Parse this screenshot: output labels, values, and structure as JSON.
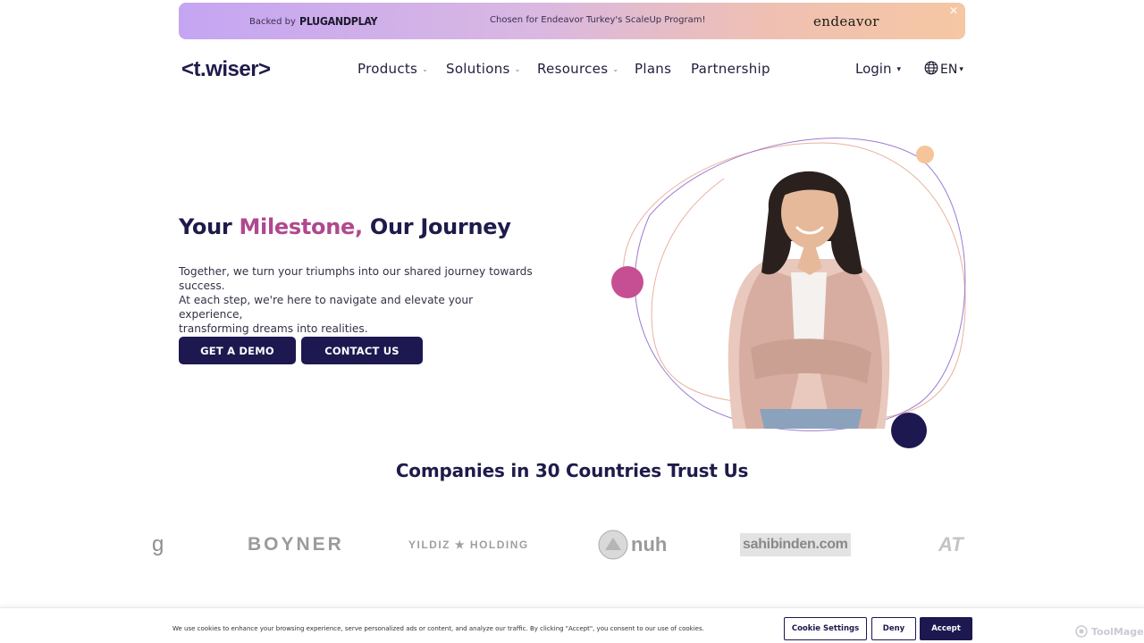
{
  "banner": {
    "backed_by": "Backed by",
    "backer_logo_text": "PLUGANDPLAY",
    "chosen_text": "Chosen for Endeavor Turkey's ScaleUp Program!",
    "endeavor_logo_text": "endeavor",
    "close_glyph": "✕"
  },
  "header": {
    "logo_text": "<t.wiser>",
    "nav": [
      {
        "label": "Products",
        "has_dropdown": true
      },
      {
        "label": "Solutions",
        "has_dropdown": true
      },
      {
        "label": "Resources",
        "has_dropdown": true
      },
      {
        "label": "Plans",
        "has_dropdown": false
      },
      {
        "label": "Partnership",
        "has_dropdown": false
      }
    ],
    "login_label": "Login",
    "language_label": "EN",
    "caret_small": "⌄",
    "caret_filled": "▾",
    "colors": {
      "primary": "#1d1850",
      "accent": "#b0488e",
      "peach": "#f6c7a3"
    }
  },
  "hero": {
    "title_part1": "Your ",
    "title_accent": "Milestone,",
    "title_part2": " Our Journey",
    "paragraph_lines": [
      "Together, we turn your triumphs into our shared journey towards success.",
      "At each step, we're here to navigate and elevate your experience,",
      "transforming dreams into realities."
    ],
    "cta_demo": "GET A DEMO",
    "cta_contact": "CONTACT US"
  },
  "trust": {
    "title": "Companies in 30 Countries Trust Us",
    "logos": [
      "g",
      "BOYNER",
      "YILDIZ ★ HOLDING",
      "nuh",
      "sahibinden.com",
      "AT"
    ]
  },
  "cookie": {
    "text": "We use cookies to enhance your browsing experience, serve personalized ads or content, and analyze our traffic. By clicking \"Accept\", you consent to our use of cookies.",
    "settings_label": "Cookie Settings",
    "deny_label": "Deny",
    "accept_label": "Accept"
  },
  "watermark": "ToolMage"
}
